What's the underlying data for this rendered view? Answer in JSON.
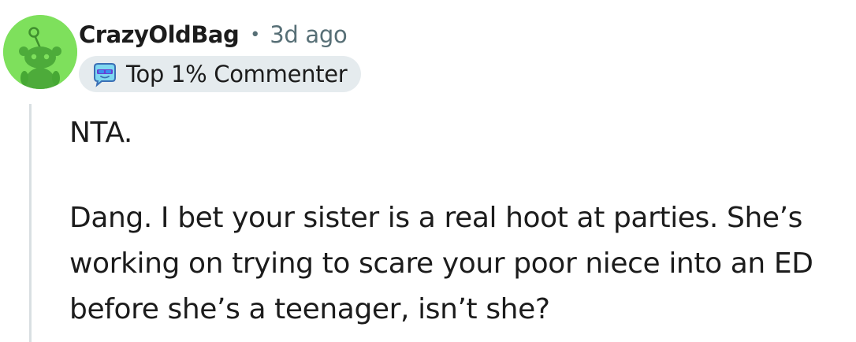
{
  "comment": {
    "username": "CrazyOldBag",
    "separator": "•",
    "timestamp": "3d ago",
    "flair": {
      "icon": "sunglasses-snoo-icon",
      "label": "Top 1% Commenter"
    },
    "paragraphs": [
      "NTA.",
      "Dang. I bet your sister is a real hoot at parties. She’s working on trying to scare your poor niece into an ED before she’s a teenager, isn’t she?"
    ]
  },
  "colors": {
    "avatar_bg": "#7ee05c",
    "avatar_snoo": "#46a834",
    "flair_bg": "#e5ebee",
    "meta_text": "#576f76",
    "thread_line": "#d9dfe2"
  }
}
